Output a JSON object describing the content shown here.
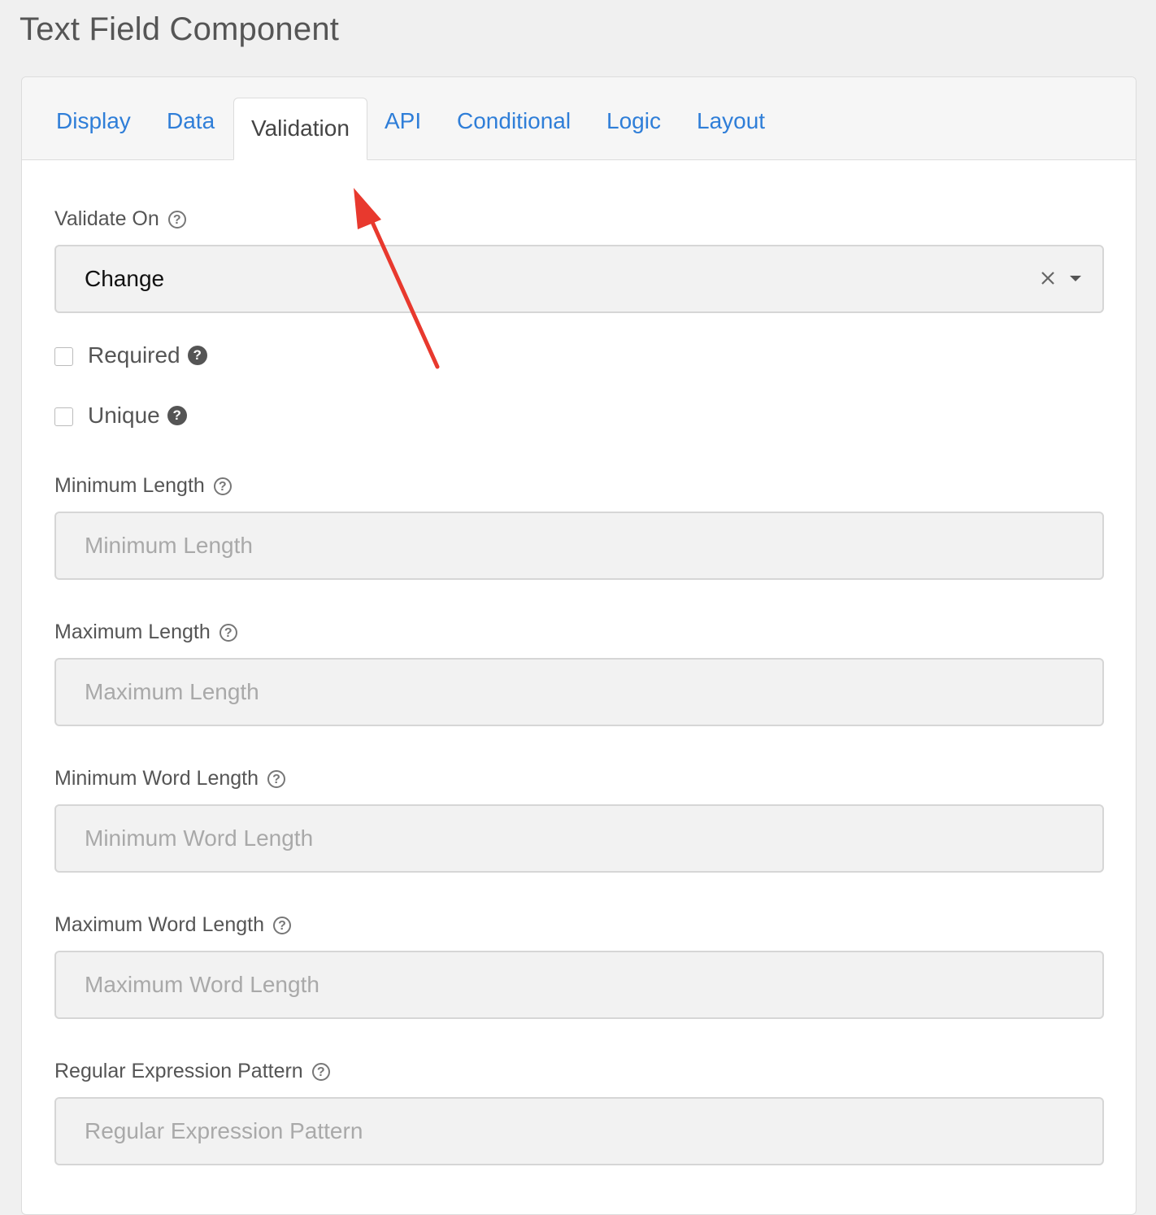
{
  "page": {
    "title": "Text Field Component"
  },
  "tabs": [
    {
      "label": "Display"
    },
    {
      "label": "Data"
    },
    {
      "label": "Validation"
    },
    {
      "label": "API"
    },
    {
      "label": "Conditional"
    },
    {
      "label": "Logic"
    },
    {
      "label": "Layout"
    }
  ],
  "active_tab": "Validation",
  "validate_on": {
    "label": "Validate On",
    "value": "Change"
  },
  "required": {
    "label": "Required",
    "checked": false
  },
  "unique": {
    "label": "Unique",
    "checked": false
  },
  "min_length": {
    "label": "Minimum Length",
    "placeholder": "Minimum Length",
    "value": ""
  },
  "max_length": {
    "label": "Maximum Length",
    "placeholder": "Maximum Length",
    "value": ""
  },
  "min_word_length": {
    "label": "Minimum Word Length",
    "placeholder": "Minimum Word Length",
    "value": ""
  },
  "max_word_length": {
    "label": "Maximum Word Length",
    "placeholder": "Maximum Word Length",
    "value": ""
  },
  "regex_pattern": {
    "label": "Regular Expression Pattern",
    "placeholder": "Regular Expression Pattern",
    "value": ""
  },
  "icons": {
    "help": "question-circle-icon",
    "help_filled": "question-circle-filled-icon",
    "clear": "close-icon",
    "dropdown": "caret-down-icon",
    "annotation": "red-arrow-icon"
  },
  "colors": {
    "link": "#2f7ed8",
    "annotation": "#e8392e"
  }
}
